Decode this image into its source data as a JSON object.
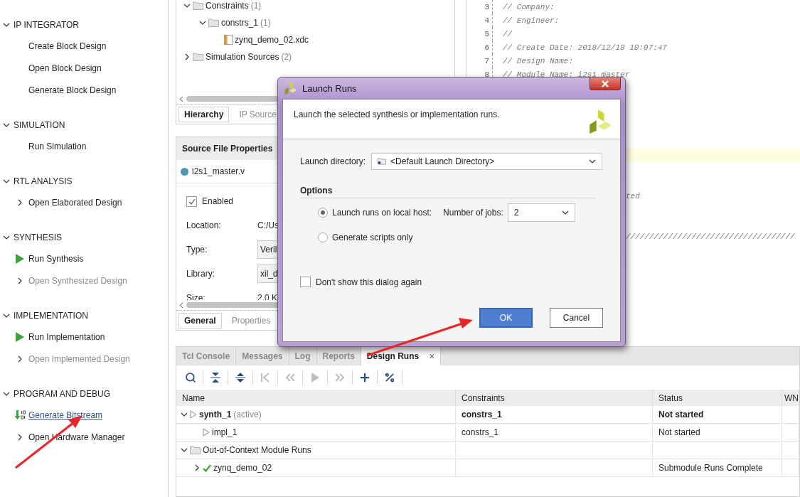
{
  "flow_navigator": {
    "sections": [
      {
        "title": "IP INTEGRATOR",
        "expanded": true,
        "items": [
          {
            "label": "Create Block Design",
            "kind": "plain",
            "disabled": false
          },
          {
            "label": "Open Block Design",
            "kind": "plain",
            "disabled": false
          },
          {
            "label": "Generate Block Design",
            "kind": "plain",
            "disabled": false
          }
        ]
      },
      {
        "title": "SIMULATION",
        "expanded": true,
        "items": [
          {
            "label": "Run Simulation",
            "kind": "plain",
            "disabled": false
          }
        ]
      },
      {
        "title": "RTL ANALYSIS",
        "expanded": true,
        "items": [
          {
            "label": "Open Elaborated Design",
            "kind": "expand",
            "disabled": false
          }
        ]
      },
      {
        "title": "SYNTHESIS",
        "expanded": true,
        "items": [
          {
            "label": "Run Synthesis",
            "kind": "run",
            "disabled": false
          },
          {
            "label": "Open Synthesized Design",
            "kind": "expand",
            "disabled": true
          }
        ]
      },
      {
        "title": "IMPLEMENTATION",
        "expanded": true,
        "items": [
          {
            "label": "Run Implementation",
            "kind": "run",
            "disabled": false
          },
          {
            "label": "Open Implemented Design",
            "kind": "expand",
            "disabled": true
          }
        ]
      },
      {
        "title": "PROGRAM AND DEBUG",
        "expanded": true,
        "items": [
          {
            "label": "Generate Bitstream",
            "kind": "bitstream",
            "disabled": false
          },
          {
            "label": "Open Hardware Manager",
            "kind": "expand",
            "disabled": false
          }
        ]
      }
    ]
  },
  "sources": {
    "tree": [
      {
        "label": "Constraints",
        "count": "(1)",
        "kind": "folder",
        "expanded": true,
        "children": [
          {
            "label": "constrs_1",
            "count": "(1)",
            "kind": "folder",
            "expanded": true,
            "children": [
              {
                "label": "zynq_demo_02.xdc",
                "kind": "file"
              }
            ]
          }
        ]
      },
      {
        "label": "Simulation Sources",
        "count": "(2)",
        "kind": "folder",
        "expanded": false
      }
    ],
    "tabs": [
      {
        "label": "Hierarchy",
        "selected": true
      },
      {
        "label": "IP Source",
        "selected": false
      }
    ]
  },
  "properties": {
    "title": "Source File Properties",
    "file": "i2s1_master.v",
    "enabled": {
      "label": "Enabled",
      "checked": true
    },
    "fields": [
      {
        "label": "Location:",
        "value": "C:/Us",
        "kind": "text"
      },
      {
        "label": "Type:",
        "value": "Veril",
        "kind": "box"
      },
      {
        "label": "Library:",
        "value": "xil_d",
        "kind": "box"
      },
      {
        "label": "Size:",
        "value": "2.0 K",
        "kind": "text"
      }
    ],
    "tabs": [
      {
        "label": "General",
        "selected": true
      },
      {
        "label": "Properties",
        "selected": false
      }
    ]
  },
  "editor": {
    "lines": [
      {
        "kind": "code",
        "number": "3",
        "text": "// Company:"
      },
      {
        "kind": "code",
        "number": "4",
        "text": "// Engineer:"
      },
      {
        "kind": "code",
        "number": "5",
        "text": "//"
      },
      {
        "kind": "code",
        "number": "6",
        "text": "// Create Date: 2018/12/18 10:07:47"
      },
      {
        "kind": "code",
        "number": "7",
        "text": "// Design Name:"
      },
      {
        "kind": "code",
        "number": "8",
        "text": "// Module Name: i2s1_master"
      },
      {
        "kind": "blank"
      },
      {
        "kind": "blank"
      },
      {
        "kind": "blank"
      },
      {
        "kind": "blank"
      },
      {
        "kind": "blank"
      },
      {
        "kind": "blank",
        "highlighted": true
      },
      {
        "kind": "blank"
      },
      {
        "kind": "blank"
      },
      {
        "kind": "fragment",
        "text": "ted"
      },
      {
        "kind": "blank"
      },
      {
        "kind": "blank"
      },
      {
        "kind": "fragment",
        "text": "////////////////////////////////////"
      }
    ]
  },
  "dialog": {
    "title": "Launch Runs",
    "description": "Launch the selected synthesis or implementation runs.",
    "directory": {
      "label": "Launch directory:",
      "value": "<Default Launch Directory>"
    },
    "options_title": "Options",
    "choices": [
      {
        "label": "Launch runs on local host:",
        "selected": true,
        "jobs": {
          "label": "Number of jobs:",
          "value": "2"
        }
      },
      {
        "label": "Generate scripts only",
        "selected": false
      }
    ],
    "dont_show": {
      "label": "Don't show this dialog again",
      "checked": false
    },
    "buttons": [
      {
        "label": "OK",
        "kind": "primary"
      },
      {
        "label": "Cancel",
        "kind": "secondary"
      }
    ]
  },
  "runs_panel": {
    "tabs": [
      {
        "label": "Tcl Console",
        "selected": false
      },
      {
        "label": "Messages",
        "selected": false
      },
      {
        "label": "Log",
        "selected": false
      },
      {
        "label": "Reports",
        "selected": false
      },
      {
        "label": "Design Runs",
        "selected": true,
        "close": "×"
      }
    ],
    "toolbar": [
      {
        "kind": "search",
        "disabled": false
      },
      {
        "kind": "collapse",
        "disabled": false
      },
      {
        "kind": "expand",
        "disabled": false
      },
      {
        "kind": "first",
        "disabled": true
      },
      {
        "kind": "previous",
        "disabled": true
      },
      {
        "kind": "play",
        "disabled": true
      },
      {
        "kind": "next",
        "disabled": true
      },
      {
        "kind": "add",
        "disabled": false
      },
      {
        "kind": "percent",
        "disabled": false
      }
    ],
    "columns": [
      "Name",
      "Constraints",
      "Status",
      "WN"
    ],
    "rows": [
      {
        "kind": "run",
        "name": "synth_1",
        "note": "(active)",
        "active": true,
        "expanded": true,
        "constraints": "constrs_1",
        "status": "Not started",
        "children": [
          {
            "kind": "run",
            "name": "impl_1",
            "active": false,
            "constraints": "constrs_1",
            "status": "Not started"
          }
        ]
      },
      {
        "kind": "folder",
        "name": "Out-of-Context Module Runs",
        "active": false,
        "expanded": true,
        "children": [
          {
            "kind": "module",
            "name": "zynq_demo_02",
            "active": false,
            "expanded": false,
            "status": "Submodule Runs Complete"
          }
        ]
      }
    ]
  }
}
